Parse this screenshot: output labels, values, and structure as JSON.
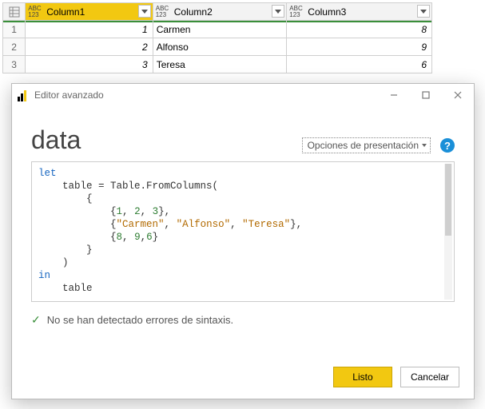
{
  "grid": {
    "type_icon_top": "ABC",
    "type_icon_bottom": "123",
    "columns": [
      "Column1",
      "Column2",
      "Column3"
    ],
    "selected_column_index": 0,
    "row_numbers": [
      "1",
      "2",
      "3"
    ],
    "rows": [
      {
        "c1": "1",
        "c2": "Carmen",
        "c3": "8"
      },
      {
        "c1": "2",
        "c2": "Alfonso",
        "c3": "9"
      },
      {
        "c1": "3",
        "c2": "Teresa",
        "c3": "6"
      }
    ]
  },
  "dialog": {
    "title": "Editor avanzado",
    "query_name": "data",
    "presentation_options_label": "Opciones de presentación",
    "help_symbol": "?",
    "code": {
      "l1_kw": "let",
      "l2a": "    table = Table.FromColumns(",
      "l3": "        {",
      "l4a": "            {",
      "l4n1": "1",
      "l4s1": ", ",
      "l4n2": "2",
      "l4s2": ", ",
      "l4n3": "3",
      "l4e": "},",
      "l5a": "            {",
      "l5s1": "\"Carmen\"",
      "l5c1": ", ",
      "l5s2": "\"Alfonso\"",
      "l5c2": ", ",
      "l5s3": "\"Teresa\"",
      "l5e": "},",
      "l6a": "            {",
      "l6n1": "8",
      "l6s1": ", ",
      "l6n2": "9",
      "l6s2": ",",
      "l6n3": "6",
      "l6e": "}",
      "l7": "        }",
      "l8": "    )",
      "l9_kw": "in",
      "l10": "    table"
    },
    "status": {
      "check": "✓",
      "text": "No se han detectado errores de sintaxis."
    },
    "buttons": {
      "ok": "Listo",
      "cancel": "Cancelar"
    }
  }
}
